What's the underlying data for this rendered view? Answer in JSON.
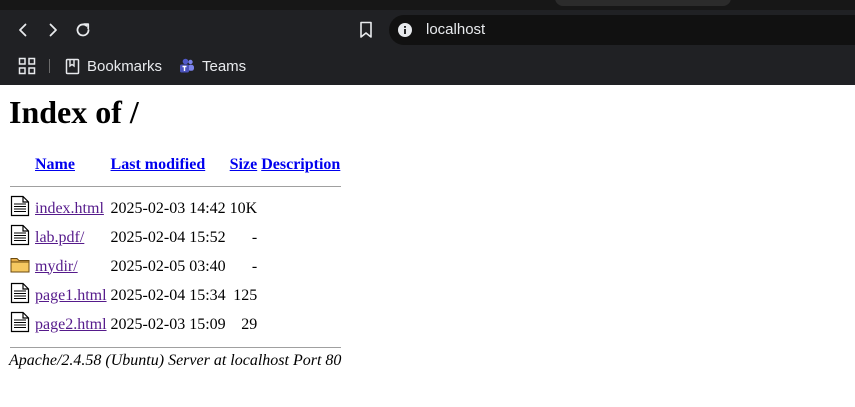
{
  "browser": {
    "address_url": "localhost",
    "bookmarks": [
      {
        "label": "Bookmarks",
        "icon": "bookmarks-folder-icon"
      },
      {
        "label": "Teams",
        "icon": "teams-icon"
      }
    ]
  },
  "page": {
    "title": "Index of /",
    "columns": {
      "name": "Name",
      "last_modified": "Last modified",
      "size": "Size",
      "description": "Description"
    },
    "rows": [
      {
        "icon": "file-icon",
        "name": "index.html",
        "modified": "2025-02-03 14:42",
        "size": "10K"
      },
      {
        "icon": "file-icon",
        "name": "lab.pdf/",
        "modified": "2025-02-04 15:52",
        "size": "-"
      },
      {
        "icon": "folder-icon",
        "name": "mydir/",
        "modified": "2025-02-05 03:40",
        "size": "-"
      },
      {
        "icon": "file-icon",
        "name": "page1.html",
        "modified": "2025-02-04 15:34",
        "size": "125"
      },
      {
        "icon": "file-icon",
        "name": "page2.html",
        "modified": "2025-02-03 15:09",
        "size": "29"
      }
    ],
    "footer": "Apache/2.4.58 (Ubuntu) Server at localhost Port 80"
  }
}
